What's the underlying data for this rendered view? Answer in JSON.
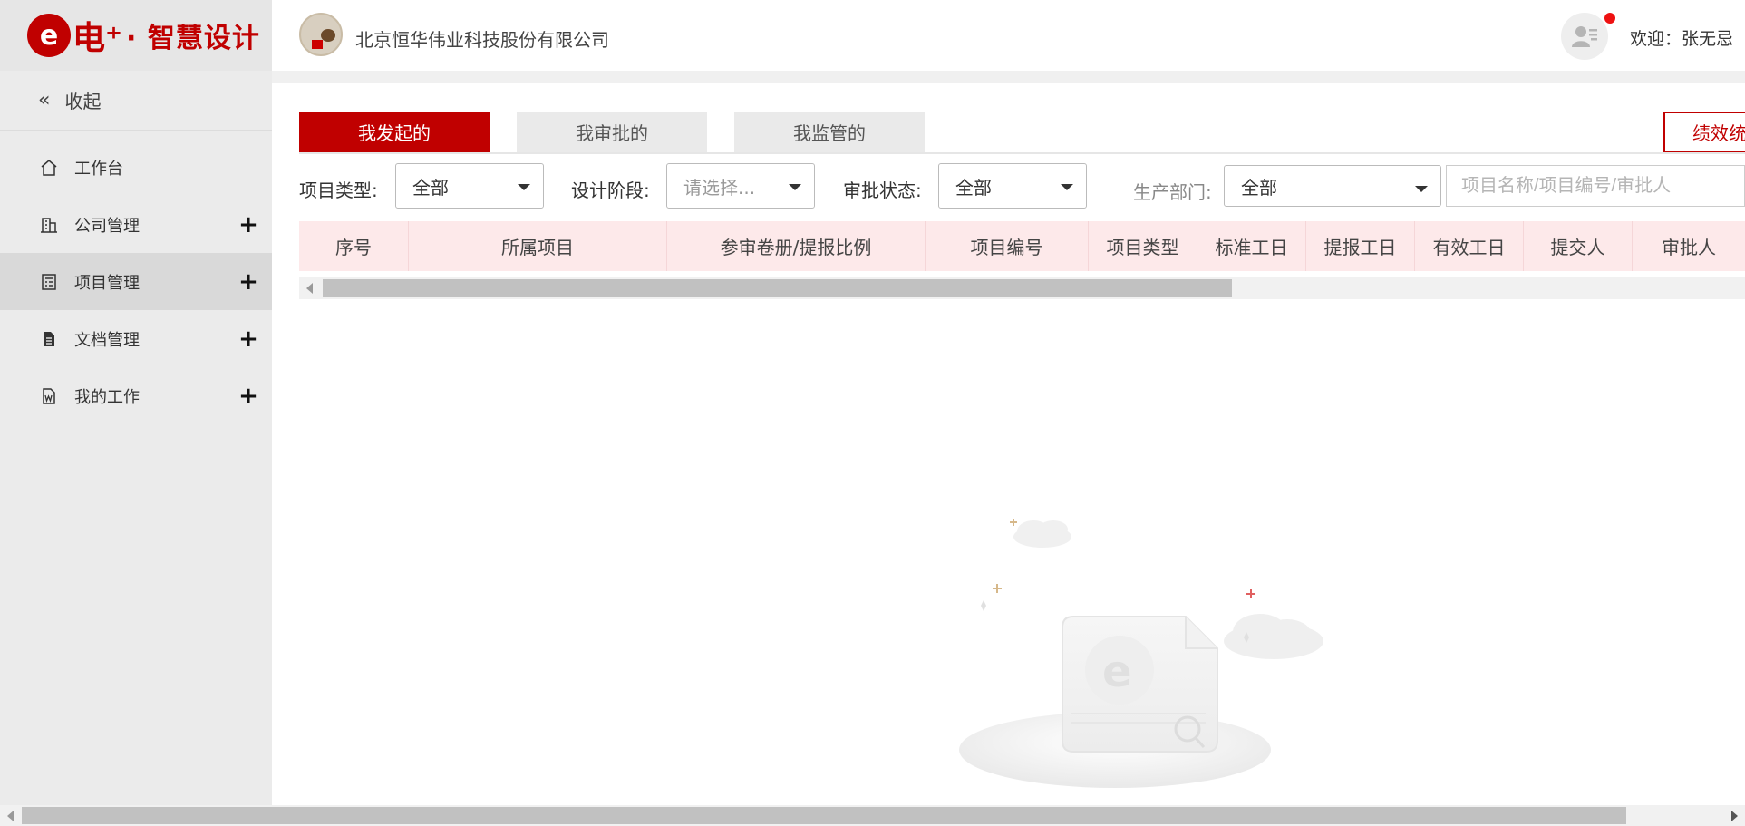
{
  "brand": {
    "logo_glyph": "电⁺",
    "logo_text": "· 智慧设计"
  },
  "sidebar": {
    "collapse_label": "收起",
    "items": [
      {
        "label": "工作台",
        "icon": "home-icon",
        "expandable": false,
        "active": false
      },
      {
        "label": "公司管理",
        "icon": "building-icon",
        "expandable": true,
        "active": false
      },
      {
        "label": "项目管理",
        "icon": "calculator-icon",
        "expandable": true,
        "active": true
      },
      {
        "label": "文档管理",
        "icon": "document-icon",
        "expandable": true,
        "active": false
      },
      {
        "label": "我的工作",
        "icon": "word-file-icon",
        "expandable": true,
        "active": false
      }
    ]
  },
  "header": {
    "company_name": "北京恒华伟业科技股份有限公司",
    "welcome": "欢迎：张无忌"
  },
  "tabs": [
    {
      "label": "我发起的",
      "active": true
    },
    {
      "label": "我审批的",
      "active": false
    },
    {
      "label": "我监管的",
      "active": false
    }
  ],
  "perf_button_label": "绩效统",
  "filters": {
    "project_type_label": "项目类型:",
    "project_type_value": "全部",
    "design_stage_label": "设计阶段:",
    "design_stage_placeholder": "请选择...",
    "approval_status_label": "审批状态:",
    "approval_status_value": "全部",
    "department_label": "生产部门:",
    "department_value": "全部",
    "search_placeholder": "项目名称/项目编号/审批人"
  },
  "table": {
    "columns": [
      "序号",
      "所属项目",
      "参审卷册/提报比例",
      "项目编号",
      "项目类型",
      "标准工日",
      "提报工日",
      "有效工日",
      "提交人",
      "审批人"
    ]
  },
  "colors": {
    "accent": "#c00000",
    "header_row": "#fde9ea"
  }
}
